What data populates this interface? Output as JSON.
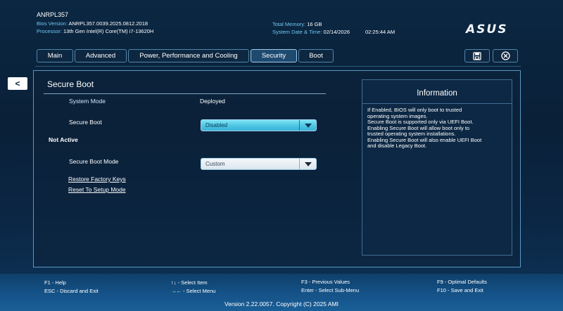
{
  "header": {
    "model": "ANRPL357",
    "bios_label": "Bios Version:",
    "bios_value": "ANRPL357.0039.2025.0812.2018",
    "proc_label": "Processor:",
    "proc_value": "13th Gen Intel(R) Core(TM) i7-13620H",
    "mem_label": "Total Memory:",
    "mem_value": "16 GB",
    "date_label": "System Date & Time:",
    "date_value": "02/14/2026",
    "time_value": "02:25:44 AM",
    "logo": "ASUS"
  },
  "tabs": {
    "main": "Main",
    "advanced": "Advanced",
    "power": "Power, Performance and Cooling",
    "security": "Security",
    "boot": "Boot",
    "active": "Security"
  },
  "toolbar": {
    "back": "<",
    "save_icon": "save-icon",
    "exit_icon": "exit-icon"
  },
  "secure_boot": {
    "title": "Secure Boot",
    "system_mode_label": "System Mode",
    "system_mode_value": "Deployed",
    "secure_boot_label": "Secure Boot",
    "secure_boot_value": "Disabled",
    "status": "Not Active",
    "secure_boot_mode_label": "Secure Boot Mode",
    "secure_boot_mode_value": "Custom",
    "restore_keys": "Restore Factory Keys",
    "reset_setup": "Reset To Setup Mode"
  },
  "info": {
    "title": "Information",
    "text": "If Enabled, BIOS will only boot to trusted\noperating system images.\nSecure Boot is supported only via UEFI Boot.\nEnabling Secure Boot will allow boot only to\ntrusted operating system installations.\nEnabling Secure Boot will also enable UEFI Boot\nand disable Legacy Boot."
  },
  "footer": {
    "f1": "F1 - Help",
    "esc": "ESC - Discard and Exit",
    "select_item": "↑↓ - Select Item",
    "select_menu": "→← - Select Menu",
    "f3": "F3 - Previous Values",
    "enter": "Enter - Select Sub-Menu",
    "f9": "F9 - Optimal Defaults",
    "f10": "F10 - Save and Exit",
    "version": "Version 2.22.0057. Copyright (C) 2025 AMI"
  },
  "colors": {
    "background": "#0a2038",
    "accent": "#6fc6f2",
    "dropdown_selected": "#4cc6e4",
    "footer": "#145186"
  }
}
